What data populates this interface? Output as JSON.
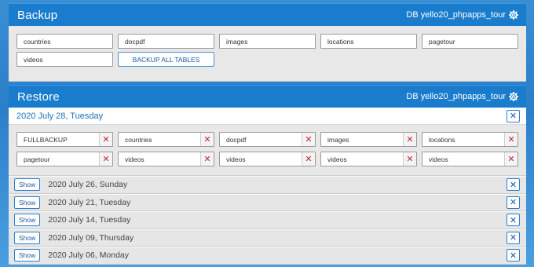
{
  "backup": {
    "title": "Backup",
    "db_label": "DB yello20_phpapps_tour",
    "tables": [
      "countries",
      "docpdf",
      "images",
      "locations",
      "pagetour",
      "videos"
    ],
    "backup_all_label": "BACKUP ALL TABLES"
  },
  "restore": {
    "title": "Restore",
    "db_label": "DB yello20_phpapps_tour",
    "open_date": "2020 July 28, Tuesday",
    "files": [
      "FULLBACKUP",
      "countries",
      "docpdf",
      "images",
      "locations",
      "pagetour",
      "videos",
      "videos",
      "videos",
      "videos"
    ],
    "delete_glyph": "✕",
    "close_glyph": "✕",
    "show_label": "Show",
    "history": [
      "2020 July 26, Sunday",
      "2020 July 21, Tuesday",
      "2020 July 14, Tuesday",
      "2020 July 09, Thursday",
      "2020 July 06, Monday"
    ]
  },
  "icons": {
    "settings": "gear-icon",
    "delete": "x-icon",
    "close": "x-icon"
  },
  "colors": {
    "header_bar": "#1a7ccc",
    "delete_red": "#c0282d",
    "accent_blue": "#1a6fc0"
  }
}
